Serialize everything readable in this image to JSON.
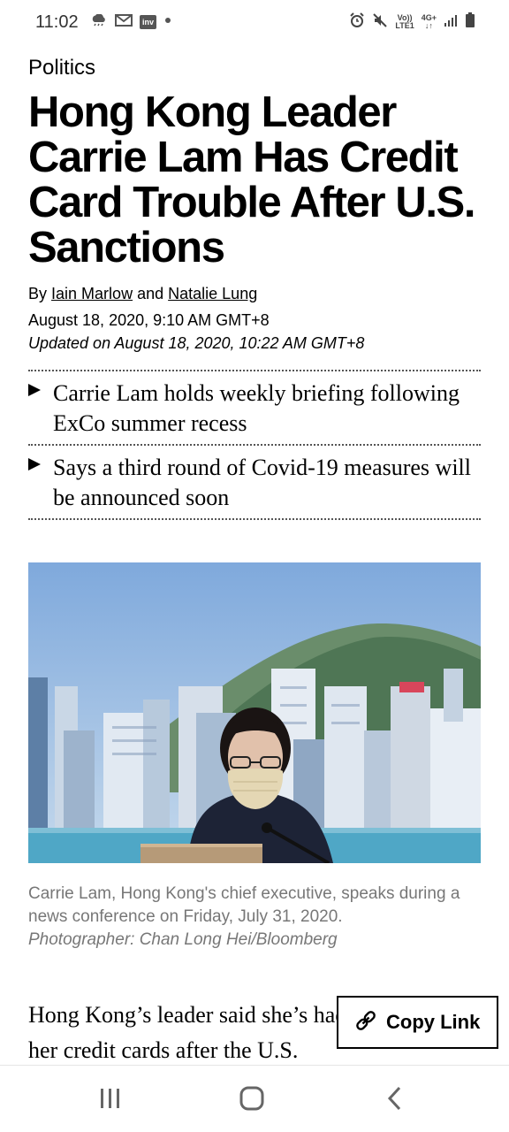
{
  "status_bar": {
    "time": "11:02",
    "left_icons": [
      "cloud-rain-icon",
      "mail-icon",
      "inv-app-icon",
      "dot-icon"
    ],
    "inv_label": "inv",
    "right_icons": [
      "alarm-icon",
      "mute-icon",
      "volte-icon",
      "signal-4g-icon",
      "signal-bars-icon",
      "battery-icon"
    ],
    "volte_top": "Vo))",
    "volte_bottom": "LTE1",
    "net_top": "4G+",
    "net_bottom": "↓↑"
  },
  "article": {
    "section": "Politics",
    "headline": "Hong Kong Leader Carrie Lam Has Credit Card Trouble After U.S. Sanctions",
    "byline_prefix": "By",
    "author1": "Iain Marlow",
    "byline_and": "and",
    "author2": "Natalie Lung",
    "published": "August 18, 2020, 9:10 AM GMT+8",
    "updated": "Updated on  August 18, 2020, 10:22 AM GMT+8",
    "bullets": [
      "Carrie Lam holds weekly briefing following ExCo summer recess",
      "Says a third round of Covid-19 measures will be announced soon"
    ],
    "caption": "Carrie Lam, Hong Kong's chief executive, speaks during a news conference on Friday, July 31, 2020.",
    "photo_credit": "Photographer: Chan Long Hei/Bloomberg",
    "body_start": "Hong Kong’s leader said she’s had trouble using her credit cards after the U.S."
  },
  "copy_link": {
    "label": "Copy Link",
    "icon": "link-icon"
  },
  "nav_bar": {
    "icons": [
      "recent-apps-icon",
      "home-icon",
      "back-icon"
    ]
  }
}
